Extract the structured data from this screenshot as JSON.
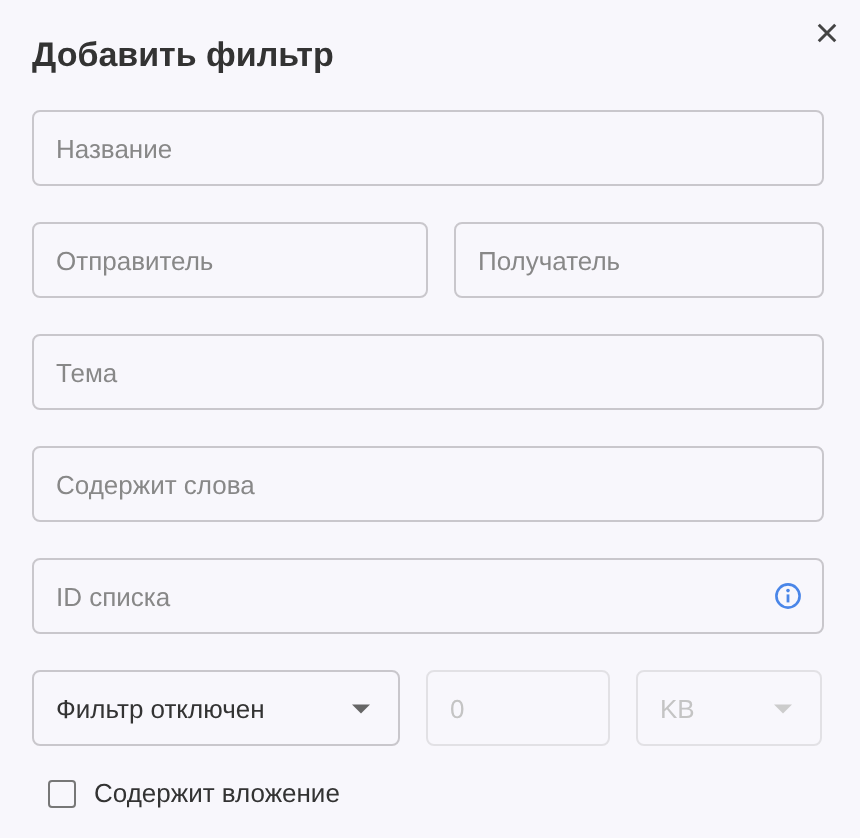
{
  "dialog": {
    "title": "Добавить фильтр"
  },
  "fields": {
    "name": {
      "placeholder": "Название"
    },
    "sender": {
      "placeholder": "Отправитель"
    },
    "recipient": {
      "placeholder": "Получатель"
    },
    "subject": {
      "placeholder": "Тема"
    },
    "words": {
      "placeholder": "Содержит слова"
    },
    "list_id": {
      "placeholder": "ID списка"
    }
  },
  "size_filter": {
    "mode": "Фильтр отключен",
    "value": "0",
    "unit": "KB",
    "disabled": true
  },
  "attachment": {
    "label": "Содержит вложение",
    "checked": false
  }
}
